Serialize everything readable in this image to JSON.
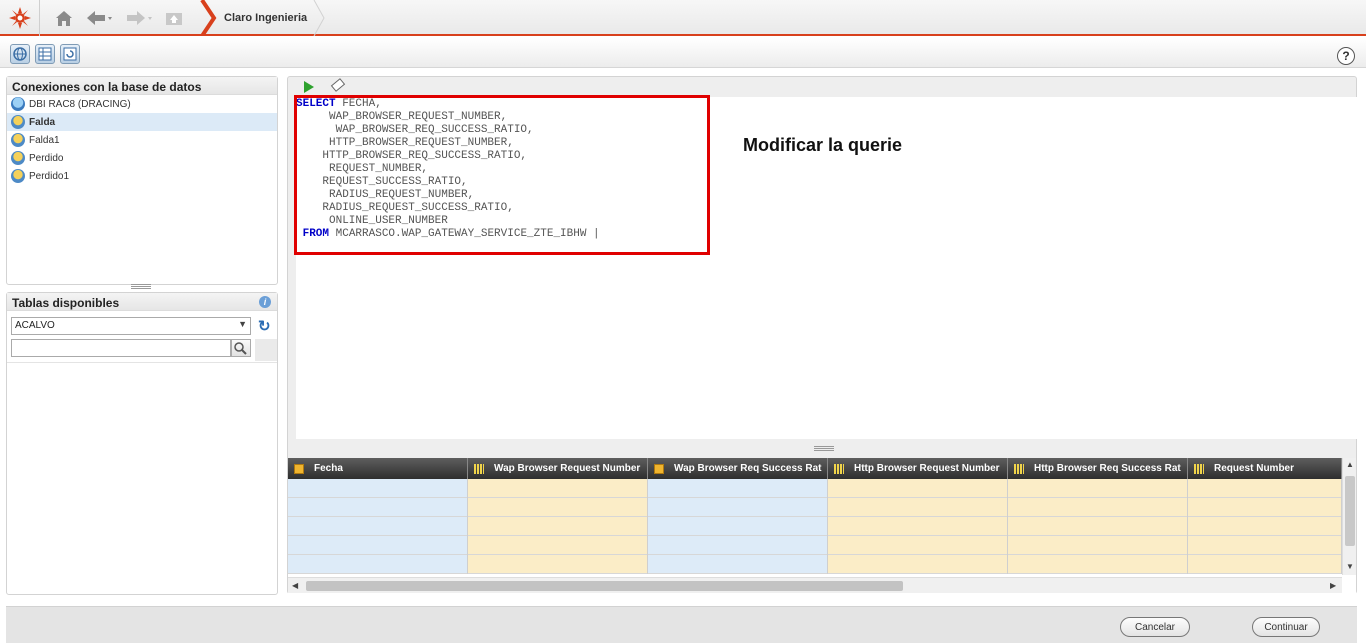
{
  "header": {
    "breadcrumb": "Claro Ingenieria"
  },
  "help_label": "?",
  "connections": {
    "title": "Conexiones con la base de datos",
    "items": [
      {
        "label": "DBI RAC8 (DRACING)",
        "icon": "database-icon",
        "selected": false
      },
      {
        "label": "Falda",
        "icon": "connection-icon",
        "selected": true
      },
      {
        "label": "Falda1",
        "icon": "connection-icon",
        "selected": false
      },
      {
        "label": "Perdido",
        "icon": "connection-icon",
        "selected": false
      },
      {
        "label": "Perdido1",
        "icon": "connection-icon",
        "selected": false
      }
    ]
  },
  "tables": {
    "title": "Tablas disponibles",
    "schema_value": "ACALVO",
    "search_value": ""
  },
  "editor": {
    "sql": {
      "kw_select": "SELECT",
      "line1": " FECHA,",
      "line2": "     WAP_BROWSER_REQUEST_NUMBER,",
      "line3": "      WAP_BROWSER_REQ_SUCCESS_RATIO,",
      "line4": "     HTTP_BROWSER_REQUEST_NUMBER,",
      "line5": "    HTTP_BROWSER_REQ_SUCCESS_RATIO,",
      "line6": "     REQUEST_NUMBER,",
      "line7": "    REQUEST_SUCCESS_RATIO,",
      "line8": "     RADIUS_REQUEST_NUMBER,",
      "line9": "    RADIUS_REQUEST_SUCCESS_RATIO,",
      "line10": "     ONLINE_USER_NUMBER",
      "kw_from": "FROM",
      "line11": " MCARRASCO.WAP_GATEWAY_SERVICE_ZTE_IBHW |"
    },
    "annotation": "Modificar la querie"
  },
  "grid": {
    "columns": [
      {
        "label": "Fecha",
        "icon": "date-icon",
        "tint": "blue"
      },
      {
        "label": "Wap Browser Request Number",
        "icon": "numeric-icon",
        "tint": "yellow"
      },
      {
        "label": "Wap Browser Req Success Rat",
        "icon": "box-icon",
        "tint": "blue"
      },
      {
        "label": "Http Browser Request Number",
        "icon": "numeric-icon",
        "tint": "yellow"
      },
      {
        "label": "Http Browser Req Success Rat",
        "icon": "numeric-icon",
        "tint": "yellow"
      },
      {
        "label": "Request Number",
        "icon": "numeric-icon",
        "tint": "yellow"
      }
    ]
  },
  "footer": {
    "cancel_label": "Cancelar",
    "continue_label": "Continuar"
  },
  "colors": {
    "accent": "#d8401c",
    "highlight": "#e00000",
    "keyword": "#0000c8"
  }
}
